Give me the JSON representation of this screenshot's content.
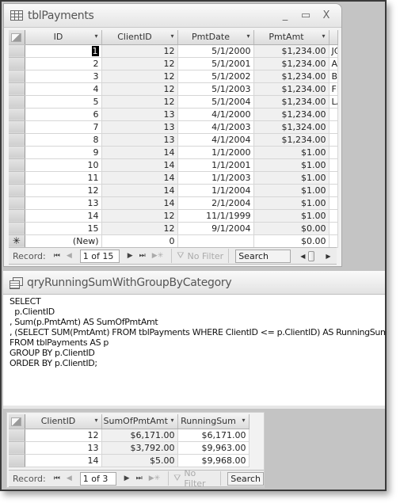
{
  "payments_window": {
    "title": "tblPayments",
    "controls": {
      "minimize": "_",
      "maximize": "▭",
      "close": "X"
    },
    "columns": [
      "ID",
      "ClientID",
      "PmtDate",
      "PmtAmt",
      ""
    ],
    "rows": [
      {
        "id": "1",
        "client": "12",
        "date": "5/1/2000",
        "amt": "$1,234.00",
        "extra": "JC"
      },
      {
        "id": "2",
        "client": "12",
        "date": "5/1/2001",
        "amt": "$1,234.00",
        "extra": "AI"
      },
      {
        "id": "3",
        "client": "12",
        "date": "5/1/2002",
        "amt": "$1,234.00",
        "extra": "B/"
      },
      {
        "id": "4",
        "client": "12",
        "date": "5/1/2003",
        "amt": "$1,234.00",
        "extra": "FF"
      },
      {
        "id": "5",
        "client": "12",
        "date": "5/1/2004",
        "amt": "$1,234.00",
        "extra": "LA"
      },
      {
        "id": "6",
        "client": "13",
        "date": "4/1/2000",
        "amt": "$1,234.00",
        "extra": ""
      },
      {
        "id": "7",
        "client": "13",
        "date": "4/1/2003",
        "amt": "$1,324.00",
        "extra": ""
      },
      {
        "id": "8",
        "client": "13",
        "date": "4/1/2004",
        "amt": "$1,234.00",
        "extra": ""
      },
      {
        "id": "9",
        "client": "14",
        "date": "1/1/2000",
        "amt": "$1.00",
        "extra": ""
      },
      {
        "id": "10",
        "client": "14",
        "date": "1/1/2001",
        "amt": "$1.00",
        "extra": ""
      },
      {
        "id": "11",
        "client": "14",
        "date": "1/1/2003",
        "amt": "$1.00",
        "extra": ""
      },
      {
        "id": "12",
        "client": "14",
        "date": "1/1/2004",
        "amt": "$1.00",
        "extra": ""
      },
      {
        "id": "13",
        "client": "14",
        "date": "2/1/2004",
        "amt": "$1.00",
        "extra": ""
      },
      {
        "id": "14",
        "client": "12",
        "date": "11/1/1999",
        "amt": "$1.00",
        "extra": ""
      },
      {
        "id": "15",
        "client": "12",
        "date": "9/1/2004",
        "amt": "$0.00",
        "extra": ""
      }
    ],
    "new_row": {
      "marker": "✳",
      "id": "(New)",
      "client": "0",
      "date": "",
      "amt": "$0.00",
      "extra": ""
    },
    "navigator": {
      "label": "Record:",
      "position": "1 of 15",
      "filter_label": "No Filter",
      "search_label": "Search"
    }
  },
  "query_window": {
    "title": "qryRunningSumWithGroupByCategory",
    "sql_lines": [
      "SELECT",
      "  p.ClientID",
      ", Sum(p.PmtAmt) AS SumOfPmtAmt",
      ", (SELECT SUM(PmtAmt) FROM tblPayments WHERE ClientID <= p.ClientID) AS RunningSum",
      "FROM tblPayments AS p",
      "GROUP BY p.ClientID",
      "ORDER BY p.ClientID;"
    ],
    "columns": [
      "ClientID",
      "SumOfPmtAmt",
      "RunningSum"
    ],
    "rows": [
      {
        "client": "12",
        "sum": "$6,171.00",
        "running": "$6,171.00"
      },
      {
        "client": "13",
        "sum": "$3,792.00",
        "running": "$9,963.00"
      },
      {
        "client": "14",
        "sum": "$5.00",
        "running": "$9,968.00"
      }
    ],
    "navigator": {
      "label": "Record:",
      "position": "1 of 3",
      "filter_label": "No Filter",
      "search_label": "Search"
    }
  },
  "icons": {
    "dropdown": "▾",
    "first": "⏮",
    "prev": "◀",
    "next": "▶",
    "last": "⏭",
    "new": "▶✳",
    "filter": "⛛"
  }
}
